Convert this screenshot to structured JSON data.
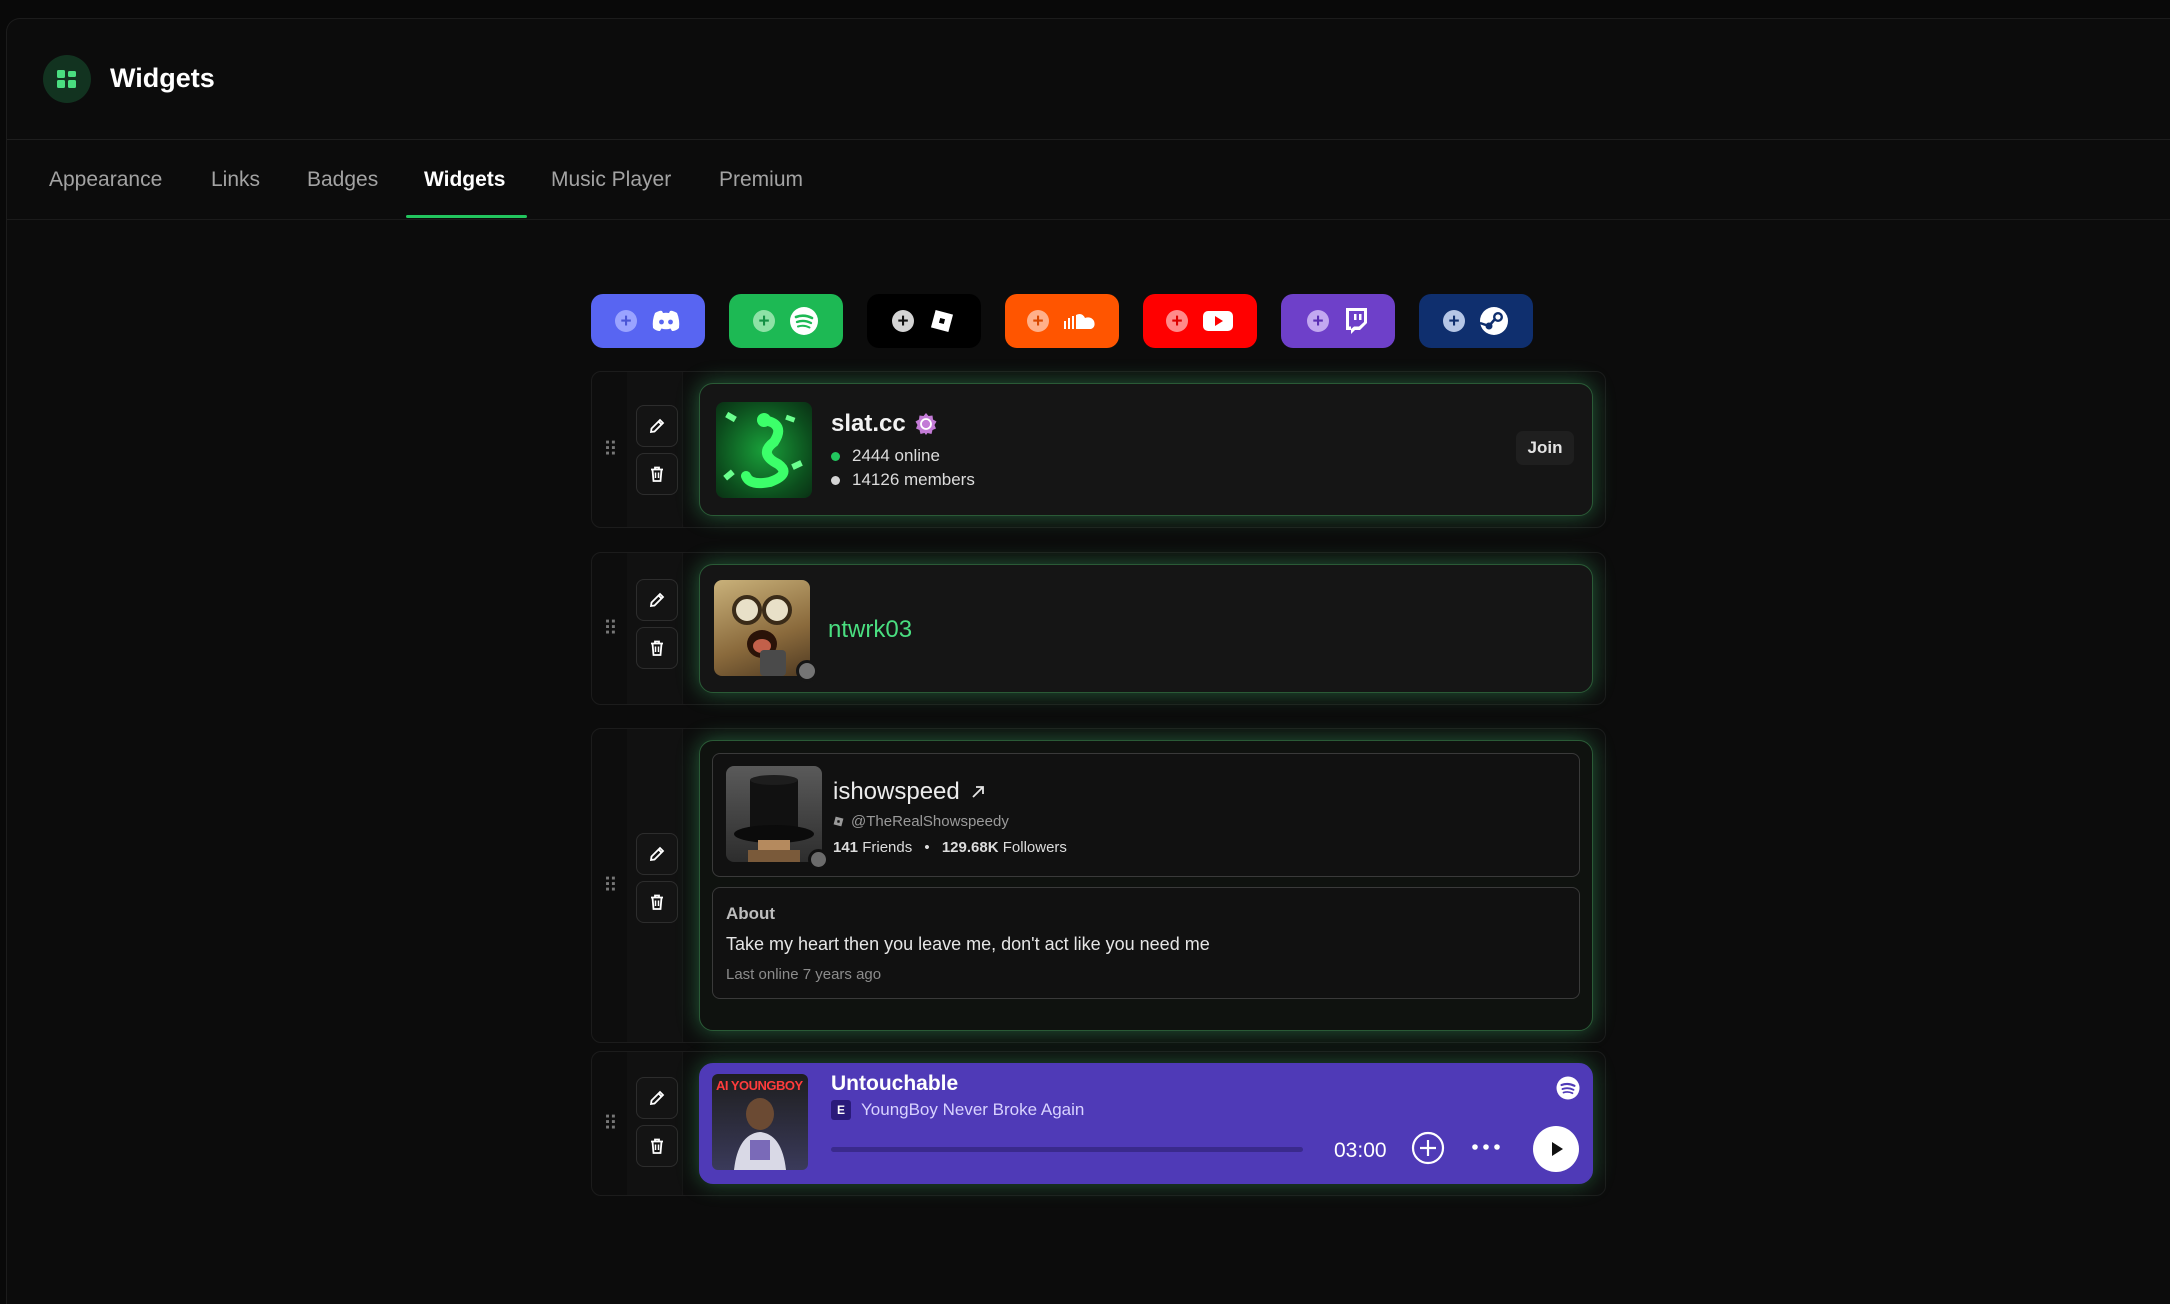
{
  "header": {
    "title": "Widgets"
  },
  "tabs": [
    {
      "label": "Appearance"
    },
    {
      "label": "Links"
    },
    {
      "label": "Badges"
    },
    {
      "label": "Widgets",
      "active": true
    },
    {
      "label": "Music Player"
    },
    {
      "label": "Premium"
    }
  ],
  "add_buttons": [
    {
      "service": "Discord",
      "icon": "discord-icon",
      "color": "#5865f2"
    },
    {
      "service": "Spotify",
      "icon": "spotify-icon",
      "color": "#1db954"
    },
    {
      "service": "Roblox",
      "icon": "roblox-icon",
      "color": "#000000"
    },
    {
      "service": "SoundCloud",
      "icon": "soundcloud-icon",
      "color": "#ff5500"
    },
    {
      "service": "YouTube",
      "icon": "youtube-icon",
      "color": "#ff0000"
    },
    {
      "service": "Twitch",
      "icon": "twitch-icon",
      "color": "#6e40c9"
    },
    {
      "service": "Steam",
      "icon": "steam-icon",
      "color": "#0f2f6e"
    }
  ],
  "widgets": {
    "discord_server": {
      "name": "slat.cc",
      "online": "2444 online",
      "members": "14126 members",
      "join_label": "Join"
    },
    "discord_user": {
      "username": "ntwrk03"
    },
    "roblox": {
      "display_name": "ishowspeed",
      "username": "@TheRealShowspeedy",
      "friends_count": "141",
      "friends_label": "Friends",
      "followers_count": "129.68K",
      "followers_label": "Followers",
      "about_title": "About",
      "about_text": "Take my heart then you leave me, don't act like you need me",
      "last_online": "Last online 7 years ago"
    },
    "spotify": {
      "track": "Untouchable",
      "explicit": "E",
      "artist": "YoungBoy Never Broke Again",
      "duration": "03:00",
      "progress": 0,
      "album_art_text": "AI YOUNGBOY"
    }
  },
  "colors": {
    "accent": "#22c55e",
    "spotify_card": "#4f3ab7",
    "ntwrk_name": "#4ade80"
  }
}
